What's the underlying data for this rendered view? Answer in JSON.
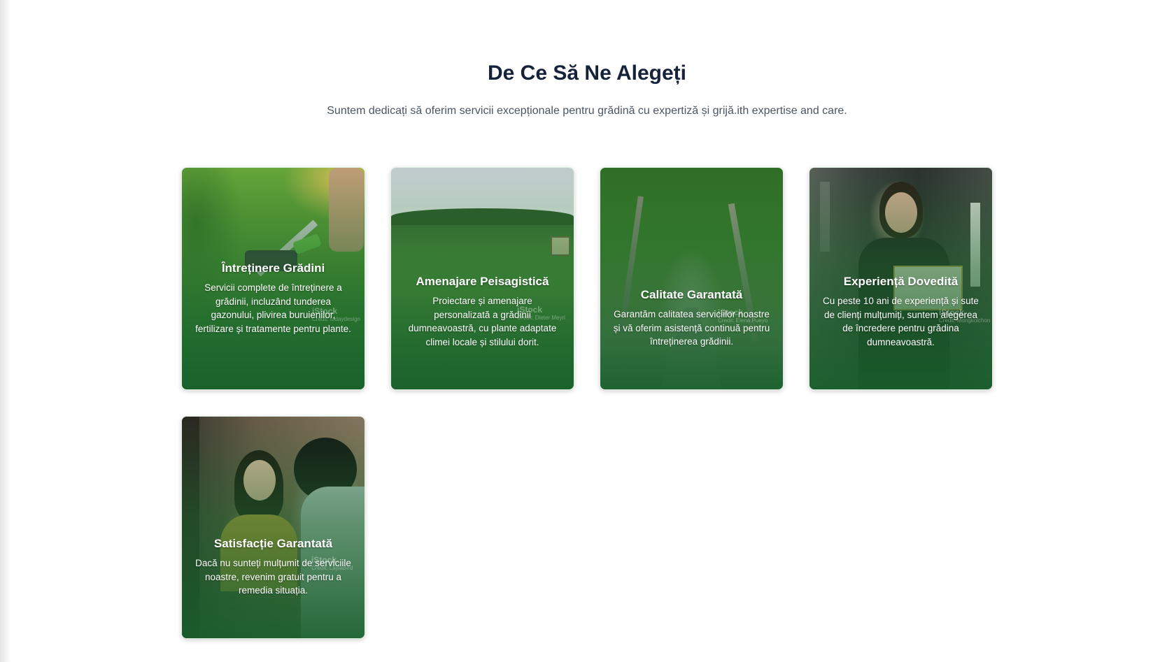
{
  "section": {
    "title": "De Ce Să Ne Alegeți",
    "subtitle": "Suntem dedicați să oferim servicii excepționale pentru grădină cu expertiză și grijă.ith expertise and care."
  },
  "cards": [
    {
      "title": "Întreținere Grădini",
      "text": "Servicii complete de întreținere a grădinii, incluzând tunderea gazonului, plivirea buruienilor, fertilizare și tratamente pentru plante.",
      "image": "lawn-mowing-photo",
      "watermark": "iStock",
      "watermark_credit": "Credit: todaydesign"
    },
    {
      "title": "Amenajare Peisagistică",
      "text": "Proiectare și amenajare personalizată a grădinii dumneavoastră, cu plante adaptate climei locale și stilului dorit.",
      "image": "landscape-garden-photo",
      "watermark": "iStock",
      "watermark_credit": "Credit: Dieter Meyrl"
    },
    {
      "title": "Calitate Garantată",
      "text": "Garantăm calitatea serviciilor noastre și vă oferim asistență continuă pentru întreținerea grădinii.",
      "image": "park-path-photo",
      "watermark": "iStock",
      "watermark_credit": "Credit: Elena Pueyo"
    },
    {
      "title": "Experiență Dovedită",
      "text": "Cu peste 10 ani de experiență și sute de clienți mulțumiți, suntem alegerea de încredere pentru grădina dumneavoastră.",
      "image": "certificate-woman-photo",
      "watermark": "iStock",
      "watermark_credit": "Credit: Mongkolchon"
    },
    {
      "title": "Satisfacție Garantată",
      "text": "Dacă nu sunteți mulțumit de serviciile noastre, revenim gratuit pentru a remedia situația.",
      "image": "smiling-client-photo",
      "watermark": "iStock",
      "watermark_credit": "Credit: LaylaBird"
    }
  ]
}
